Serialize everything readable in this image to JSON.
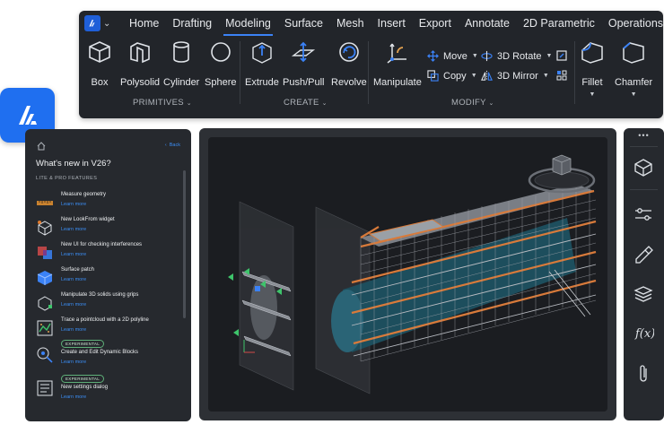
{
  "menubar": {
    "items": [
      "Home",
      "Drafting",
      "Modeling",
      "Surface",
      "Mesh",
      "Insert",
      "Export",
      "Annotate",
      "2D Parametric",
      "Operations"
    ],
    "active": "Modeling"
  },
  "ribbon": {
    "primitives": [
      "Box",
      "Polysolid",
      "Cylinder",
      "Sphere"
    ],
    "create": [
      "Extrude",
      "Push/Pull",
      "Revolve"
    ],
    "manipulate": "Manipulate",
    "modify_small": {
      "move": "Move",
      "copy": "Copy",
      "rotate3d": "3D Rotate",
      "mirror3d": "3D Mirror"
    },
    "fillet": "Fillet",
    "chamfer": "Chamfer",
    "groups": {
      "primitives": "PRIMITIVES",
      "create": "CREATE",
      "modify": "MODIFY"
    }
  },
  "left_panel": {
    "back": "Back",
    "title": "What's new in V26?",
    "section": "LITE & PRO FEATURES",
    "learn_more": "Learn more",
    "features": [
      {
        "title": "Measure geometry",
        "badge": ""
      },
      {
        "title": "New LookFrom widget",
        "badge": ""
      },
      {
        "title": "New UI for checking interferences",
        "badge": ""
      },
      {
        "title": "Surface patch",
        "badge": ""
      },
      {
        "title": "Manipulate 3D solids using grips",
        "badge": ""
      },
      {
        "title": "Trace a pointcloud with a 2D polyline",
        "badge": ""
      },
      {
        "title": "Create and Edit Dynamic Blocks",
        "badge": "EXPERIMENTAL"
      },
      {
        "title": "New settings dialog",
        "badge": "EXPERIMENTAL"
      }
    ]
  },
  "right_panel": {
    "more": "•••",
    "icons": [
      "cube-icon",
      "sliders-icon",
      "paint-icon",
      "layers-icon",
      "function-icon",
      "paperclip-icon"
    ]
  },
  "colors": {
    "accent": "#3b82f6",
    "brand": "#1f6ff0",
    "link": "#3b8ef5",
    "badge": "#5fb079"
  }
}
